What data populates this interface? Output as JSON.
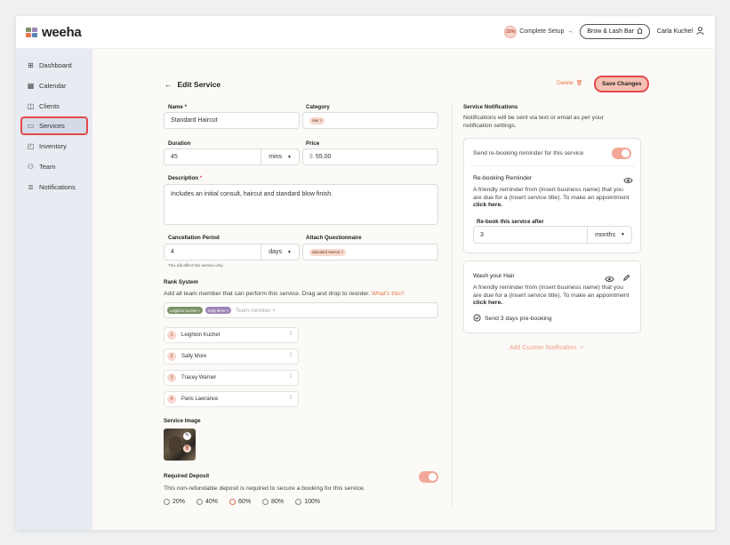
{
  "header": {
    "logo_text": "weeha",
    "setup_pct": "25%",
    "setup_label": "Complete Setup",
    "setup_arrow": "→",
    "business": "Brow & Lash Bar",
    "user": "Carla Kuchel"
  },
  "sidebar": {
    "items": [
      {
        "label": "Dashboard",
        "icon": "⊞"
      },
      {
        "label": "Calendar",
        "icon": "▦"
      },
      {
        "label": "Clients",
        "icon": "◫"
      },
      {
        "label": "Services",
        "icon": "▭"
      },
      {
        "label": "Inventory",
        "icon": "◰"
      },
      {
        "label": "Team",
        "icon": "⚇"
      },
      {
        "label": "Notifications",
        "icon": "≣"
      }
    ]
  },
  "page": {
    "back_arrow": "←",
    "title": "Edit Service",
    "delete_label": "Delete",
    "delete_icon": "🗑",
    "save_label": "Save Changes"
  },
  "form": {
    "name_label": "Name *",
    "name_value": "Standard Haircut",
    "category_label": "Category",
    "category_chip": "Hair ×",
    "duration_label": "Duration",
    "duration_value": "45",
    "duration_unit": "mins",
    "price_label": "Price",
    "price_currency": "$",
    "price_value": "55.00",
    "description_label": "Description",
    "description_req": "*",
    "description_value": "Includes an initial consult, haircut and standard blow finish.",
    "cancellation_label": "Cancellation Period",
    "cancellation_value": "4",
    "cancellation_unit": "days",
    "cancellation_note": "This will affect this service only.",
    "questionnaire_label": "Attach Questionnaire",
    "questionnaire_chip": "Standard Haircut ×",
    "rank_label": "Rank System",
    "rank_help": "Add all team member that can perform this service. Drag and drop to reorder.",
    "rank_help_link": "What's this?",
    "rank_chips": [
      "Leighton Kuchel ×",
      "Sally More ×"
    ],
    "rank_placeholder": "Team member +",
    "rank_list": [
      {
        "n": "1",
        "name": "Leighton Kuchel"
      },
      {
        "n": "2",
        "name": "Sally More"
      },
      {
        "n": "3",
        "name": "Tracey Warner"
      },
      {
        "n": "4",
        "name": "Paris Lawrance"
      }
    ],
    "image_label": "Service Image",
    "deposit_label": "Required Deposit",
    "deposit_desc": "This non-refundable deposit is required to secure a booking for this service.",
    "deposit_options": [
      "20%",
      "40%",
      "60%",
      "80%",
      "100%"
    ],
    "deposit_selected": "60%"
  },
  "notifications": {
    "title": "Service Notifications",
    "desc": "Notifications will be sent via text or email as per your notification settings.",
    "rebook_toggle_label": "Send re-booking reminder for this service",
    "rebook_title": "Re-booking Reminder",
    "rebook_text": "A friendly reminder from (insert business name) that you are due for a (insert service title). To make an appointment",
    "click_here": "click here.",
    "rebook_after_label": "Re-book this service after",
    "rebook_after_value": "3",
    "rebook_after_unit": "months",
    "wash_title": "Wash your Hair",
    "wash_text": "A friendly reminder from (insert business name) that you are due for a (insert service title). To make an appointment",
    "wash_schedule": "Send 3 days pre-booking",
    "add_custom": "Add Custom Notification",
    "add_custom_plus": "+"
  },
  "colors": {
    "accent": "#e7774f",
    "highlight": "#e24b4b",
    "sidebar_bg": "#e8ebf1"
  }
}
